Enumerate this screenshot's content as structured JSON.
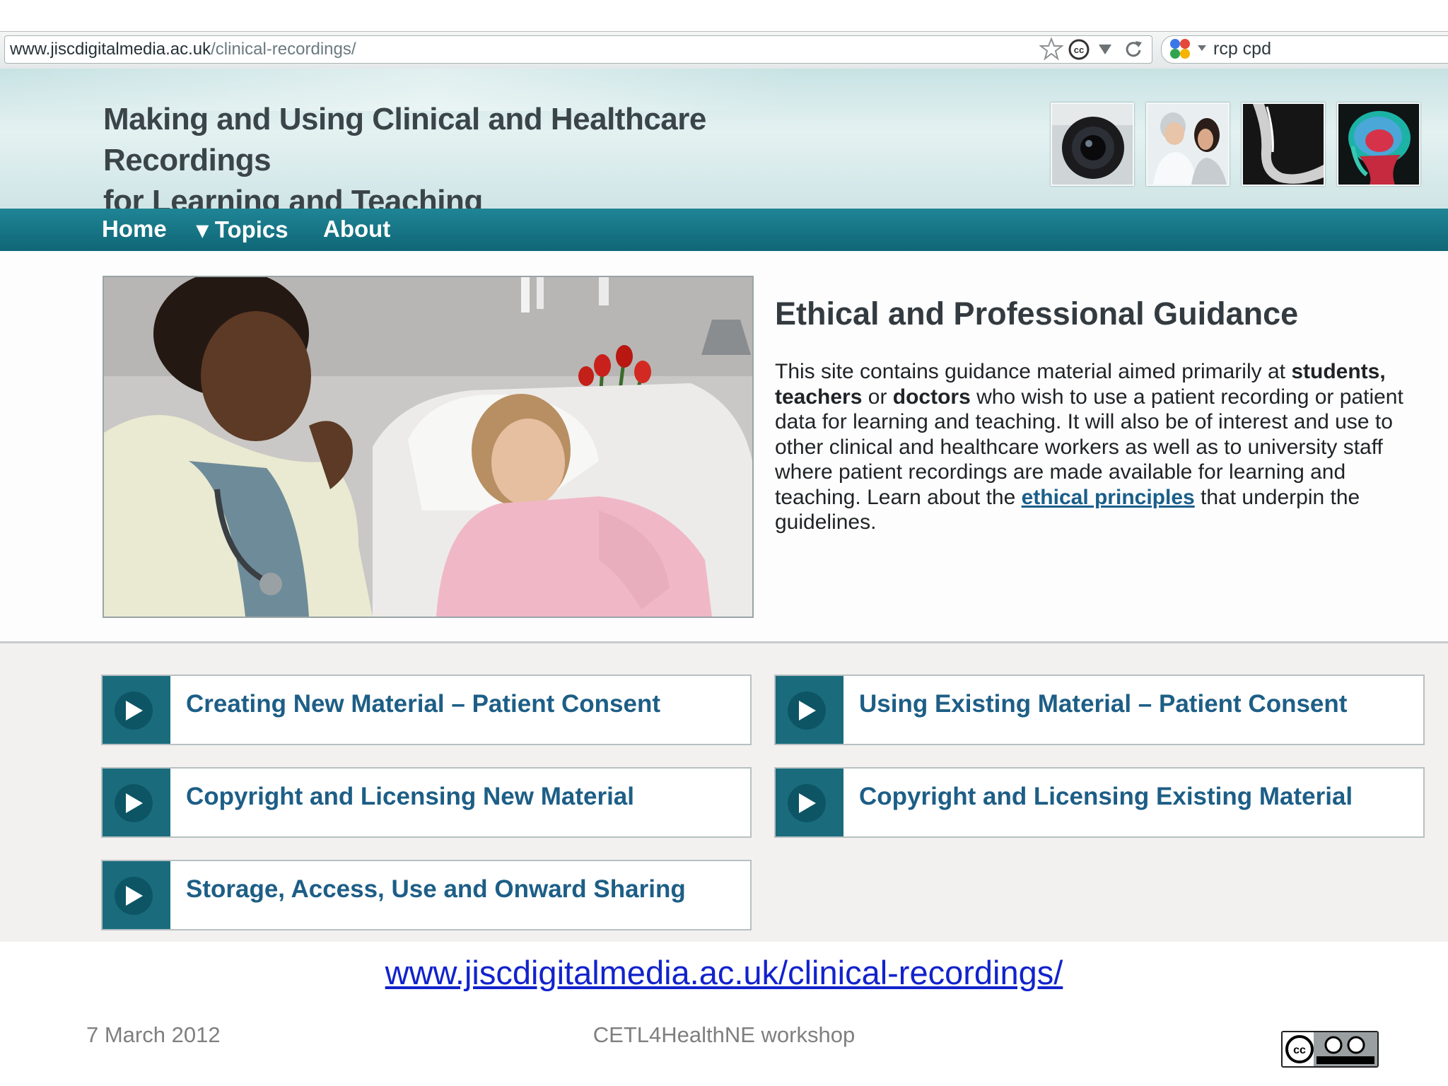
{
  "browser": {
    "url_host": "www.jiscdigitalmedia.ac.uk",
    "url_path": "/clinical-recordings/",
    "search_text": "rcp cpd"
  },
  "site": {
    "title_line1": "Making and Using Clinical and Healthcare Recordings",
    "title_line2": "for Learning and Teaching"
  },
  "nav": {
    "home": "Home",
    "topics": "▾ Topics",
    "about": "About"
  },
  "guidance": {
    "title": "Ethical and Professional Guidance",
    "p1": "This site contains guidance material aimed primarily at ",
    "students": "students,",
    "teachers": "teachers",
    "or": " or ",
    "doctors": "doctors",
    "p2": " who wish to use a patient recording or patient data for learning and teaching. It will also be of interest and use to other clinical and healthcare workers as well as to university staff where patient recordings are made available for learning and teaching. Learn about the ",
    "link": "ethical principles",
    "p3": " that underpin the guidelines."
  },
  "topics": [
    {
      "label": "Creating New Material – Patient Consent"
    },
    {
      "label": "Using Existing Material – Patient Consent"
    },
    {
      "label": "Copyright and Licensing New Material"
    },
    {
      "label": "Copyright and Licensing Existing Material"
    },
    {
      "label": "Storage, Access, Use and Onward Sharing"
    }
  ],
  "slide": {
    "link": "www.jiscdigitalmedia.ac.uk/clinical-recordings/ ",
    "date": "7 March 2012",
    "footer": "CETL4HealthNE workshop"
  },
  "colors": {
    "nav_teal": "#1a7a8a",
    "link_blue": "#1d5e86",
    "slide_link": "#1122cc"
  }
}
